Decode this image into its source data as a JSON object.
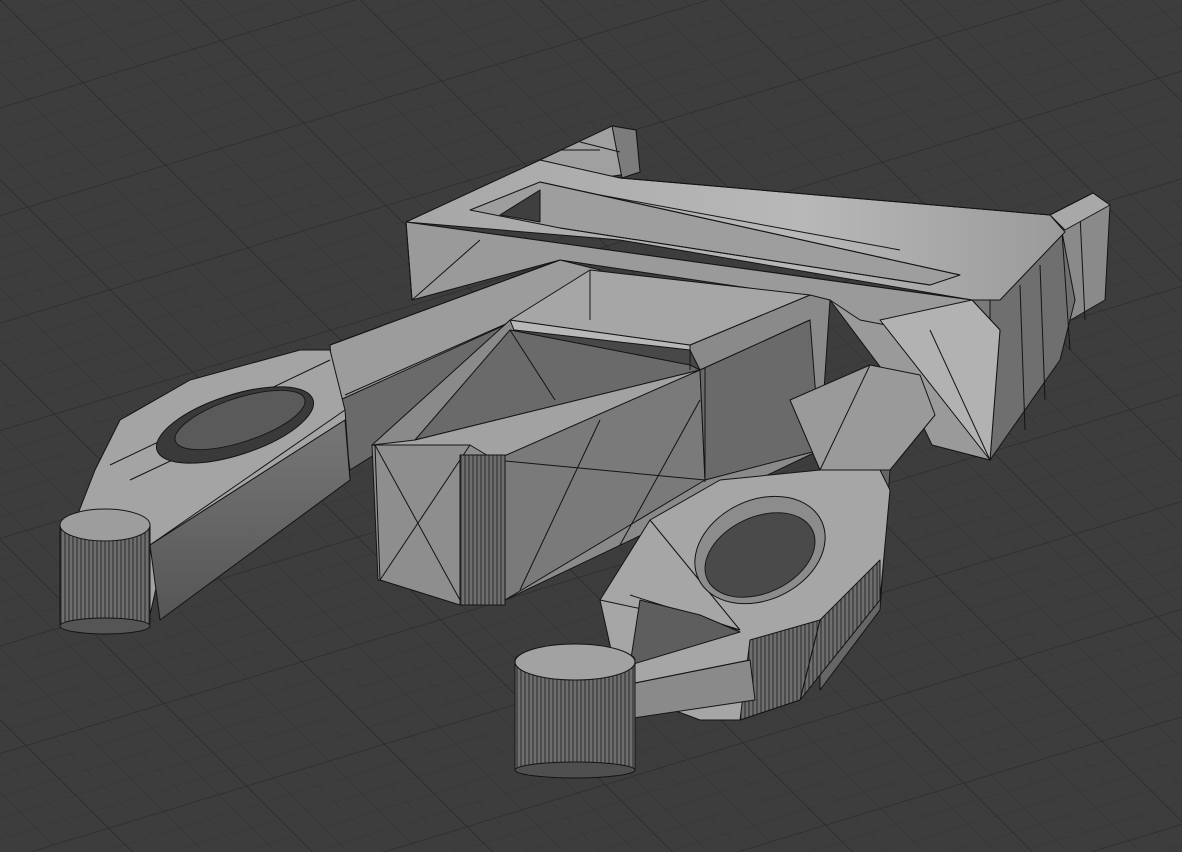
{
  "viewport": {
    "kind": "3d-viewport",
    "shading": "solid",
    "overlay": "wireframe",
    "grid": true,
    "colors": {
      "background": "#3d3d3d",
      "grid_minor": "#353535",
      "grid_major": "#2f2f2f",
      "mesh_light": "#b4b4b4",
      "mesh_mid": "#9a9a9a",
      "mesh_dark": "#6c6c6c",
      "mesh_shadow": "#505050",
      "wire": "#111111"
    }
  },
  "object": {
    "description_icon": "mesh-object-icon",
    "parts": [
      "frame-top-bar",
      "frame-left-post",
      "frame-right-post",
      "left-arm",
      "center-block",
      "right-arm",
      "left-knob",
      "right-knob"
    ]
  }
}
